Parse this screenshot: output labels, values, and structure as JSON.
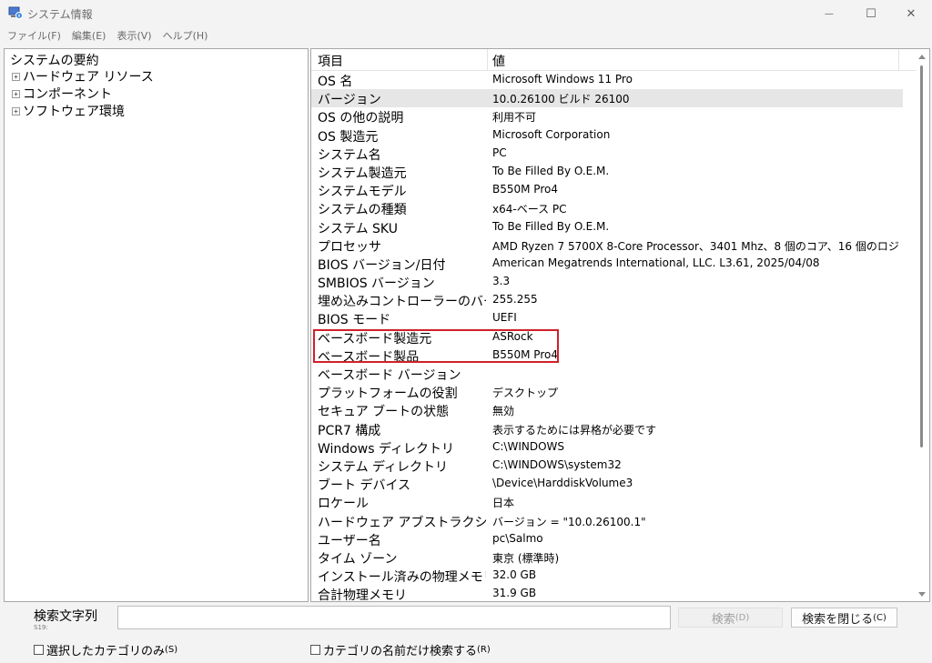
{
  "window": {
    "title": "システム情報",
    "minimize_glyph": "—",
    "maximize_glyph": "☐",
    "close_glyph": "✕"
  },
  "menu": [
    "ファイル(F)",
    "編集(E)",
    "表示(V)",
    "ヘルプ(H)"
  ],
  "tree": {
    "root": "システムの要約",
    "items": [
      {
        "expander": "+",
        "label": "ハードウェア リソース"
      },
      {
        "expander": "+",
        "label": "コンポーネント"
      },
      {
        "expander": "+",
        "label": "ソフトウェア環境"
      }
    ]
  },
  "list": {
    "columns": {
      "item": "項目",
      "value": "値"
    },
    "selected_row": "バージョン",
    "rows": [
      {
        "item": "OS 名",
        "value": "Microsoft Windows 11 Pro"
      },
      {
        "item": "バージョン",
        "value": "10.0.26100 ビルド 26100"
      },
      {
        "item": "OS の他の説明",
        "value": "利用不可"
      },
      {
        "item": "OS 製造元",
        "value": "Microsoft Corporation"
      },
      {
        "item": "システム名",
        "value": "PC"
      },
      {
        "item": "システム製造元",
        "value": "To Be Filled By O.E.M."
      },
      {
        "item": "システムモデル",
        "value": "B550M Pro4"
      },
      {
        "item": "システムの種類",
        "value": "x64-ベース PC"
      },
      {
        "item": "システム SKU",
        "value": "To Be Filled By O.E.M."
      },
      {
        "item": "プロセッサ",
        "value": "AMD Ryzen 7 5700X 8-Core Processor、3401 Mhz、8 個のコア、16 個のロジ..."
      },
      {
        "item": "BIOS バージョン/日付",
        "value": "American Megatrends International, LLC. L3.61, 2025/04/08"
      },
      {
        "item": "SMBIOS バージョン",
        "value": "3.3"
      },
      {
        "item": "埋め込みコントローラーのバー...",
        "value": "255.255"
      },
      {
        "item": "BIOS モード",
        "value": "UEFI"
      },
      {
        "item": "ベースボード製造元",
        "value": "ASRock"
      },
      {
        "item": "ベースボード製品",
        "value": "B550M Pro4"
      },
      {
        "item": "ベースボード バージョン",
        "value": ""
      },
      {
        "item": "プラットフォームの役割",
        "value": "デスクトップ"
      },
      {
        "item": "セキュア ブートの状態",
        "value": "無効"
      },
      {
        "item": "PCR7 構成",
        "value": "表示するためには昇格が必要です"
      },
      {
        "item": "Windows ディレクトリ",
        "value": "C:\\WINDOWS"
      },
      {
        "item": "システム ディレクトリ",
        "value": "C:\\WINDOWS\\system32"
      },
      {
        "item": "ブート デバイス",
        "value": "\\Device\\HarddiskVolume3"
      },
      {
        "item": "ロケール",
        "value": "日本"
      },
      {
        "item": "ハードウェア アブストラクション ...",
        "value": "バージョン = \"10.0.26100.1\""
      },
      {
        "item": "ユーザー名",
        "value": "pc\\Salmo"
      },
      {
        "item": "タイム ゾーン",
        "value": "東京 (標準時)"
      },
      {
        "item": "インストール済みの物理メモリ...",
        "value": "32.0 GB"
      },
      {
        "item": "合計物理メモリ",
        "value": "31.9 GB"
      }
    ]
  },
  "search": {
    "label": "検索文字列",
    "label_sub": "S19:",
    "input_value": "",
    "search_button": "検索",
    "search_button_key": "(D)",
    "close_button": "検索を閉じる",
    "close_button_key": "(C)",
    "checkbox_selected_only": "選択したカテゴリのみ",
    "checkbox_selected_only_key": "(S)",
    "checkbox_names_only": "カテゴリの名前だけ検索する",
    "checkbox_names_only_key": "(R)"
  },
  "colors": {
    "highlight_box": "#d0202a",
    "selected_row": "#e6e6e6"
  }
}
